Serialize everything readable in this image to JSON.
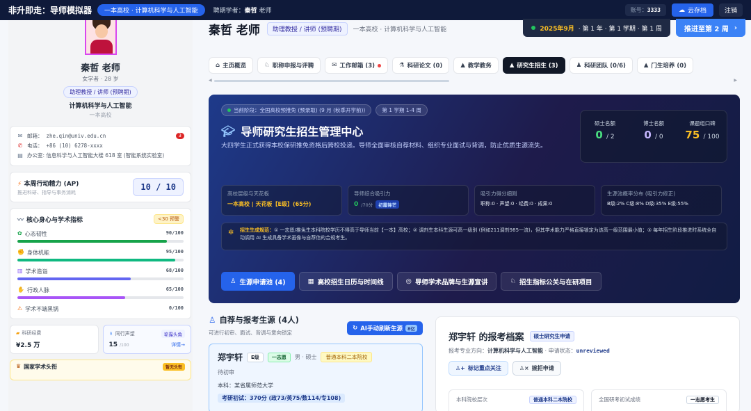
{
  "topbar": {
    "app_title": "非升即走：导师模拟器",
    "school_pill": "一本高校 · 计算机科学与人工智能",
    "hired_label": "聘期学者：",
    "hired_name": "秦哲",
    "hired_suffix": "老师",
    "account_label": "账号：",
    "account_value": "3333",
    "save_label": "云存档",
    "logout_label": "注销"
  },
  "profile": {
    "name": "秦哲 老师",
    "meta": "女学者 · 28 岁",
    "title_badge": "助理教授 / 讲师 (预聘期)",
    "field": "计算机科学与人工智能",
    "school": "一本高校",
    "avatar_label": "YOU"
  },
  "contact": {
    "email_label": "邮箱：",
    "email": "zhe.qin@univ.edu.cn",
    "email_badge": "3",
    "phone_label": "电话：",
    "phone": "+86 (10) 6278-xxxx",
    "office": "办公室: 信息科学与人工智能大楼 618 室 (智能系统实验室)"
  },
  "energy": {
    "title": "本周行动精力 (AP)",
    "subtitle": "推进科研、指导与事务消耗",
    "value": "10 / 10"
  },
  "metrics": {
    "title": "核心身心与学术指标",
    "warning": "<30 预警",
    "items": [
      {
        "label": "心态韧性",
        "value": "90/100",
        "pct": 90,
        "color": "#16a34a"
      },
      {
        "label": "身体机能",
        "value": "95/100",
        "pct": 95,
        "color": "#10b981"
      },
      {
        "label": "学术造诣",
        "value": "68/100",
        "pct": 68,
        "color": "#6366f1"
      },
      {
        "label": "行政人脉",
        "value": "65/100",
        "pct": 65,
        "color": "#a855f7"
      },
      {
        "label": "学术不端黑锅",
        "value": "0/100",
        "pct": 0,
        "color": "#ef4444"
      }
    ]
  },
  "mini": {
    "funds_label": "科研经费",
    "funds_value": "¥2.5 万",
    "rep_label": "同行声望",
    "rep_value": "15",
    "rep_max": "/100",
    "rep_tag": "崭露头角",
    "rep_link": "详情→"
  },
  "bottom_card": {
    "title": "国家学术头衔",
    "tag": "暂无头衔"
  },
  "header": {
    "name": "秦哲 老师",
    "badge": "助理教授 / 讲师 (预聘期)",
    "school": "一本高校 · 计算机科学与人工智能",
    "date_prefix": "2025年9月",
    "date_rest": "· 第 1 年 · 第 1 学期 · 第 1 周",
    "next_label": "推进至第 2 周"
  },
  "tabs": [
    {
      "label": "主页概览",
      "icon": "home-icon",
      "glyph": "⌂"
    },
    {
      "label": "职称申报与评聘",
      "icon": "award-icon",
      "glyph": "♘"
    },
    {
      "label": "工作邮箱 (3)",
      "icon": "mail-icon",
      "glyph": "✉"
    },
    {
      "label": "科研论文 (0)",
      "icon": "flask-icon",
      "glyph": "⚗"
    },
    {
      "label": "教学教务",
      "icon": "cap-icon",
      "glyph": "▲"
    },
    {
      "label": "研究生招生 (3)",
      "icon": "cap-icon",
      "glyph": "▲"
    },
    {
      "label": "科研团队 (0/6)",
      "icon": "team-icon",
      "glyph": "♟"
    },
    {
      "label": "门生培养 (0)",
      "icon": "cap-icon",
      "glyph": "▲"
    }
  ],
  "hero": {
    "phase": "当前阶段：全国高校预推免 (预录取) (9 月 (秋季开学前))",
    "term": "第 1 学期 1-4 周",
    "title": "导师研究生招生管理中心",
    "desc": "大四学生正式获得本校保研推免资格后跨校投递。导师全面审核自荐材料、组织专业面试与背调，防止优质生源流失。",
    "quota": [
      {
        "label": "硕士名额",
        "value": "0",
        "max": "/ 2",
        "color": "#4ade80"
      },
      {
        "label": "博士名额",
        "value": "0",
        "max": "/ 0",
        "color": "#c4b5fd"
      },
      {
        "label": "课题组口碑",
        "value": "75",
        "max": "/ 100",
        "color": "#fbbf24"
      }
    ],
    "stats": {
      "s1_label": "高校层级与天花板",
      "s1_value": "一本高校 | 天花板【E级】(65分)",
      "s2_label": "导师综合吸引力",
      "s2_value": "0",
      "s2_max": "/70分",
      "s2_tag": "初露锋芒",
      "s3_label": "吸引力得分细则",
      "s3_value": "职称:0 · 声望:0 · 经费:0 · 成果:0",
      "s4_label": "生源池概率分布 (吸引力修正)",
      "s4_value": "B级:2% C级:8% D级:35% E级:55%"
    },
    "rule_title": "招生生成规范：",
    "rule_text": "① 一志愿/推免生本科院校学历不得高于导师当前【一本】高校；② 调剂生本科生源可高一级别 (例如211调剂985一流)，但其学术能力严格直接锁定为该高一级范围最小值；③ 每年招生阶段推进时系统全自动调用 AI 生成具备学术画像与自荐信的合规考生。",
    "tabs": [
      {
        "label": "生源申请池 (4)",
        "icon": "users-icon",
        "glyph": "♙"
      },
      {
        "label": "高校招生日历与时间线",
        "icon": "calendar-icon",
        "glyph": "▦"
      },
      {
        "label": "导师学术品牌与生源宣讲",
        "icon": "globe-icon",
        "glyph": "◎"
      },
      {
        "label": "招生指标公关与在研项目",
        "icon": "award-icon",
        "glyph": "♘"
      }
    ]
  },
  "pool": {
    "title": "自荐与报考生源 (4人)",
    "subtitle": "可进行初审、面试、背调与意向锁定",
    "ai_label": "AI手动刷新生源",
    "ai_tag": "8亿",
    "candidate": {
      "name": "郑宇轩",
      "grade": "E级",
      "choice": "一志愿",
      "sex": "男 · 硕士",
      "school_tag": "普通本科二本院校",
      "status": "待初审",
      "ug": "本科：某省属师范大学",
      "score": "考研初试：370分 (政73/英75/数114/专108)"
    }
  },
  "dossier": {
    "title": "郑宇轩 的报考档案",
    "tag": "硕士研究生申请",
    "major_label": "报考专业方向：",
    "major": "计算机科学与人工智能",
    "status_label": " · 申请状态：",
    "status": "unreviewed",
    "btn1": "标记重点关注",
    "btn2": "婉拒申请",
    "card1_label": "本科院校层次",
    "card1_tag": "普通本科二本院校",
    "card2_label": "全国研考初试成绩",
    "card2_tag": "一志愿考生"
  }
}
